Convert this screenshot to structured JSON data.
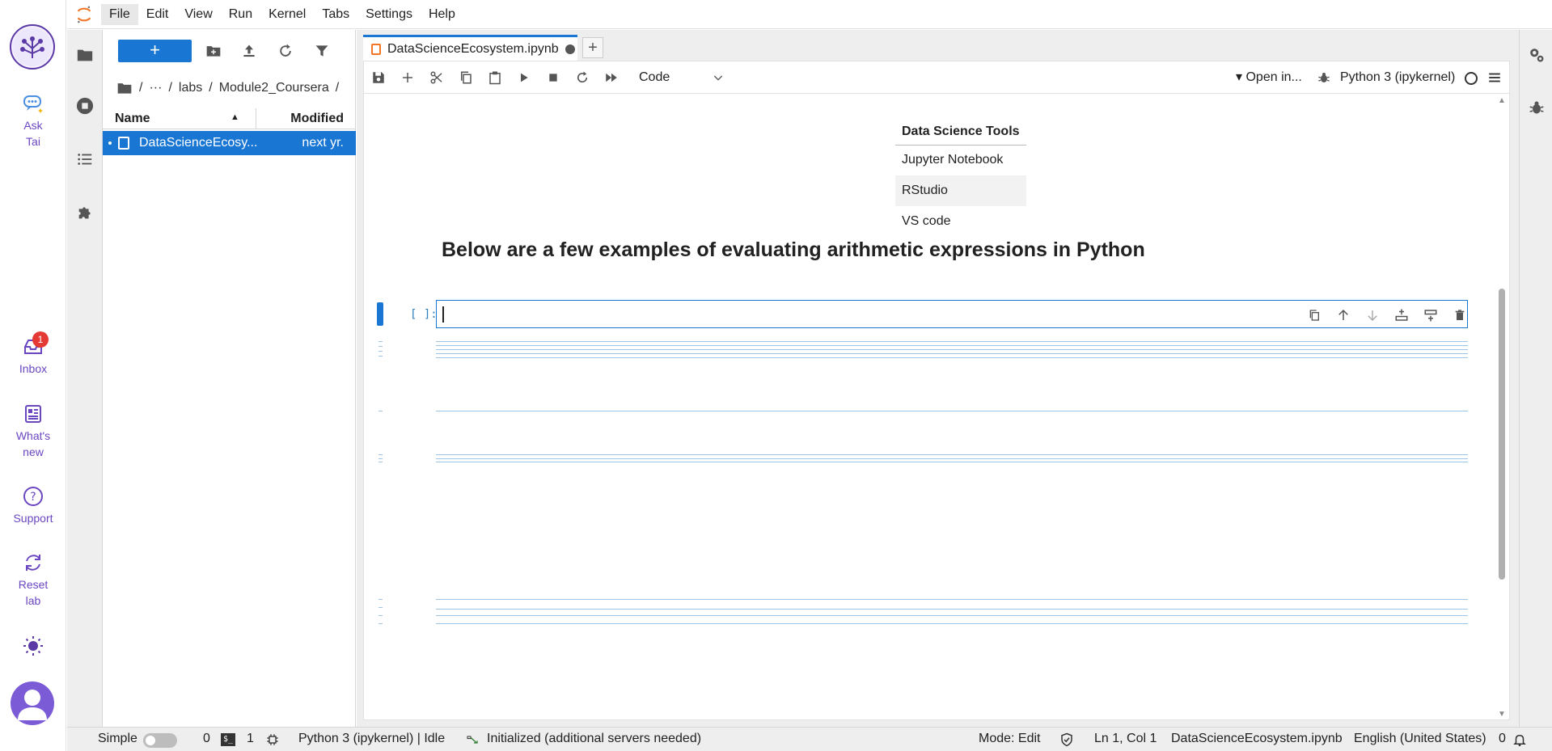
{
  "menubar": {
    "items": [
      "File",
      "Edit",
      "View",
      "Run",
      "Kernel",
      "Tabs",
      "Settings",
      "Help"
    ],
    "active": "File"
  },
  "outer_rail": {
    "items": [
      {
        "label_1": "Ask",
        "label_2": "Tai",
        "icon": "chat-bubble-icon"
      },
      {
        "label_1": "Inbox",
        "icon": "inbox-icon",
        "badge": "1"
      },
      {
        "label_1": "What's",
        "label_2": "new",
        "icon": "newspaper-icon"
      },
      {
        "label_1": "Support",
        "icon": "question-circle-icon"
      },
      {
        "label_1": "Reset",
        "label_2": "lab",
        "icon": "reset-icon"
      }
    ],
    "theme_icon": "sun-icon",
    "avatar_icon": "user-avatar-icon",
    "accent": "#6b46c1"
  },
  "file_browser": {
    "new_label": "+",
    "breadcrumb": {
      "root": "/",
      "ellipsis": "···",
      "sep1": "/",
      "labs": "labs",
      "sep2": "/",
      "module": "Module2_Coursera",
      "sep3": "/"
    },
    "columns": {
      "name": "Name",
      "modified": "Modified"
    },
    "files": [
      {
        "name": "DataScienceEcosy...",
        "modified": "next yr."
      }
    ]
  },
  "tab": {
    "label": "DataScienceEcosystem.ipynb",
    "add_label": "+"
  },
  "toolbar": {
    "cell_type": "Code",
    "open_in": "Open in...",
    "open_in_caret": "▾",
    "kernel": "Python 3 (ipykernel)"
  },
  "notebook": {
    "table": {
      "header": "Data Science Tools",
      "rows": [
        "Jupyter Notebook",
        "RStudio",
        "VS code"
      ]
    },
    "heading": "Below are a few examples of evaluating arithmetic expressions in Python",
    "cell_prompt": "[ ]:"
  },
  "statusbar": {
    "mode_label": "Simple",
    "terminals": "0",
    "kernels": "1",
    "kernel_status": "Python 3 (ipykernel) | Idle",
    "lsp": "Initialized (additional servers needed)",
    "mode": "Mode: Edit",
    "position": "Ln 1, Col 1",
    "filename": "DataScienceEcosystem.ipynb",
    "language": "English (United States)",
    "notifications": "0"
  },
  "colors": {
    "brand_blue": "#1976d2",
    "jupyter_orange": "#f37626",
    "rail_purple": "#6b46c1"
  }
}
